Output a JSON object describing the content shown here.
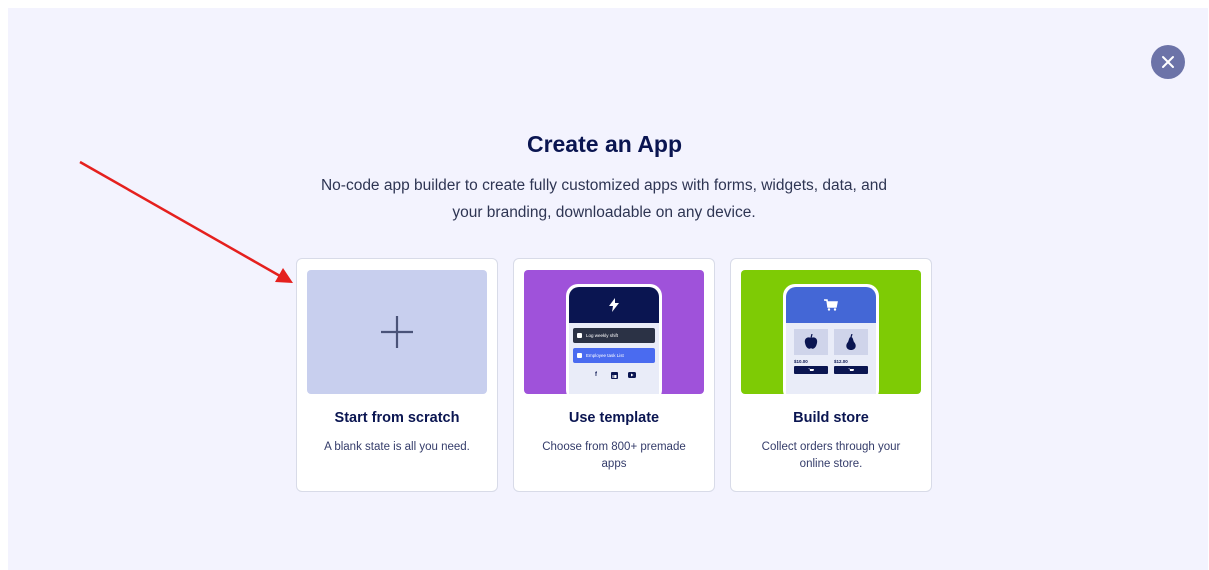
{
  "dialog": {
    "title": "Create an App",
    "subtitle": "No-code app builder to create fully customized apps with forms, widgets, data, and your branding, downloadable on any device."
  },
  "cards": [
    {
      "title": "Start from scratch",
      "description": "A blank state is all you need.",
      "icon": "plus-icon"
    },
    {
      "title": "Use template",
      "description": "Choose from 800+ premade apps",
      "preview": {
        "row1": "Log weekly shift",
        "row2": "Employee task List",
        "socials": [
          "f",
          "in",
          "yt"
        ]
      }
    },
    {
      "title": "Build store",
      "description": "Collect orders through your online store.",
      "preview": {
        "price1": "$10.00",
        "price2": "$12.00"
      }
    }
  ],
  "colors": {
    "overlay": "#f3f3fe",
    "close_button": "#6c73a8",
    "scratch_thumb": "#c8cfee",
    "template_thumb": "#9f52da",
    "store_thumb": "#7ecb05",
    "annotation_arrow": "#e5201e"
  }
}
